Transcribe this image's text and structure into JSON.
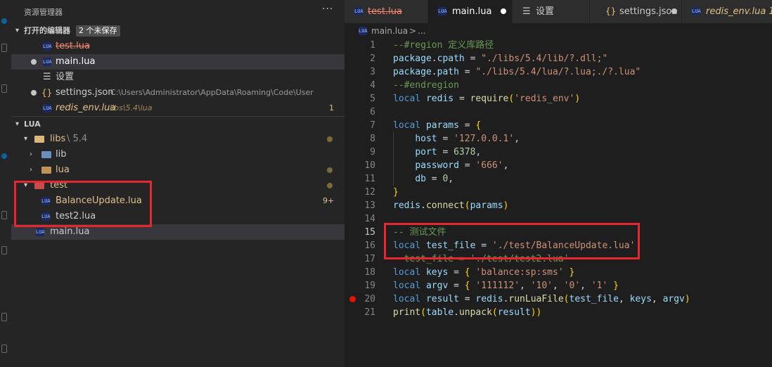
{
  "explorer": {
    "title": "资源管理器",
    "more": "···",
    "open_editors": {
      "title": "打开的编辑器",
      "badge": "2 个未保存",
      "items": [
        {
          "name": "test.lua",
          "path": "",
          "extra": ""
        },
        {
          "name": "main.lua",
          "path": "",
          "extra": ""
        },
        {
          "name": "设置",
          "path": "",
          "extra": ""
        },
        {
          "name": "settings.json",
          "path": "C:\\Users\\Administrator\\AppData\\Roaming\\Code\\User",
          "extra": ""
        },
        {
          "name": "redis_env.lua",
          "path": "libs\\5.4\\lua",
          "extra": "1"
        }
      ]
    },
    "workspace": {
      "title": "LUA",
      "tree": [
        {
          "name": "libs",
          "suffix": "\\ 5.4",
          "extra": ""
        },
        {
          "name": "lib",
          "suffix": "",
          "extra": ""
        },
        {
          "name": "lua",
          "suffix": "",
          "extra": ""
        },
        {
          "name": "test",
          "suffix": "",
          "extra": ""
        },
        {
          "name": "BalanceUpdate.lua",
          "suffix": "",
          "extra": "9+"
        },
        {
          "name": "test2.lua",
          "suffix": "",
          "extra": ""
        },
        {
          "name": "main.lua",
          "suffix": "",
          "extra": ""
        }
      ]
    }
  },
  "tabs": [
    {
      "label": "test.lua"
    },
    {
      "label": "main.lua"
    },
    {
      "label": "设置"
    },
    {
      "label": "settings.json"
    },
    {
      "label": "redis_env.lua 1"
    }
  ],
  "breadcrumb": {
    "file": "main.lua",
    "sep": ">",
    "rest": "..."
  },
  "code": {
    "numbers": [
      "1",
      "2",
      "3",
      "4",
      "5",
      "6",
      "7",
      "8",
      "9",
      "10",
      "11",
      "12",
      "13",
      "14",
      "15",
      "16",
      "17",
      "18",
      "19",
      "20",
      "21"
    ],
    "lines": [
      "--#region 定义库路径",
      "package.cpath = \"./libs/5.4/lib/?.dll;\"",
      "package.path = \"./libs/5.4/lua/?.lua;./?.lua\"",
      "--#endregion",
      "local redis = require('redis_env')",
      "",
      "local params = {",
      "    host = '127.0.0.1',",
      "    port = 6378,",
      "    password = '666',",
      "    db = 0,",
      "}",
      "redis.connect(params)",
      "",
      "-- 测试文件",
      "local test_file = './test/BalanceUpdate.lua'",
      "--test_file = './test/test2.lua'",
      "local keys = { 'balance:sp:sms' }",
      "local argv = { '111112', '10', '0', '1' }",
      "local result = redis.runLuaFile(test_file, keys, argv)",
      "print(table.unpack(result))"
    ],
    "breakpoint_line": "20",
    "current_line": "15"
  },
  "colors": {
    "annotation_box": "#e8262e",
    "modified": "#e2c08d",
    "deleted": "#f48771",
    "breakpoint": "#e51400"
  }
}
